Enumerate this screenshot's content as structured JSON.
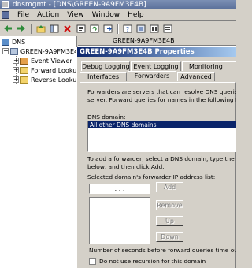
{
  "window": {
    "title": "dnsmgmt - [DNS\\GREEN-9A9FM3E4B]"
  },
  "menu": {
    "items": [
      {
        "label": "File"
      },
      {
        "label": "Action"
      },
      {
        "label": "View"
      },
      {
        "label": "Window"
      },
      {
        "label": "Help"
      }
    ]
  },
  "toolbar": {
    "icons": [
      "back-icon",
      "forward-icon",
      "up-icon",
      "show-tree-icon",
      "delete-icon",
      "properties-icon",
      "refresh-icon",
      "export-icon",
      "help-icon",
      "new-record-icon",
      "new-zone-icon",
      "list-icon",
      "detail-icon"
    ]
  },
  "tree": {
    "root": "DNS",
    "server": "GREEN-9A9FM3E4B",
    "children": [
      {
        "label": "Event Viewer"
      },
      {
        "label": "Forward Lookup Zones",
        "display": "Forward Lookup ."
      },
      {
        "label": "Reverse Lookup Zones",
        "display": "Reverse Lookup ."
      }
    ]
  },
  "right_pane": {
    "column_header": "GREEN-9A9FM3E4B"
  },
  "dialog": {
    "title": "GREEN-9A9FM3E4B Properties",
    "tabs_row1": [
      {
        "label": "Debug Logging"
      },
      {
        "label": "Event Logging"
      },
      {
        "label": "Monitoring"
      }
    ],
    "tabs_row2": [
      {
        "label": "Interfaces"
      },
      {
        "label": "Forwarders",
        "active": true
      },
      {
        "label": "Advanced"
      }
    ],
    "forwarders": {
      "intro_line1": "Forwarders are servers that can resolve DNS queries not a",
      "intro_line2": "server. Forward queries for names in the following DNS do",
      "domain_label": "DNS domain:",
      "domain_selected": "All other DNS domains",
      "add_help_line1": "To add a forwarder, select a DNS domain, type the forwar",
      "add_help_line2": "below, and then click Add.",
      "ip_list_label": "Selected domain's forwarder IP address list:",
      "ip_placeholder": ".   .   .",
      "buttons": {
        "add": "Add",
        "remove": "Remove",
        "up": "Up",
        "down": "Down"
      },
      "timeout_label": "Number of seconds before forward queries time out:",
      "no_recursion_label": "Do not use recursion for this domain"
    }
  }
}
